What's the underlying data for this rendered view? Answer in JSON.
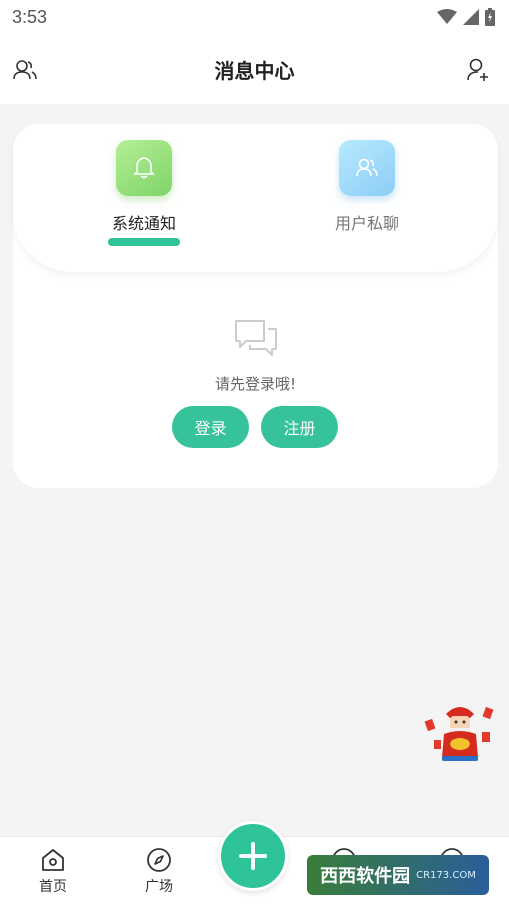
{
  "status_bar": {
    "time": "3:53"
  },
  "header": {
    "title": "消息中心"
  },
  "tabs": [
    {
      "label": "系统通知",
      "icon": "bell-icon",
      "active": true
    },
    {
      "label": "用户私聊",
      "icon": "users-icon",
      "active": false
    }
  ],
  "empty_state": {
    "icon": "chat-bubbles-icon",
    "text": "请先登录哦!",
    "login_label": "登录",
    "register_label": "注册"
  },
  "bottom_nav": {
    "home_label": "首页",
    "square_label": "广场",
    "fab_icon": "plus-icon"
  },
  "watermark": {
    "main": "西西软件园",
    "sub": "CR173.COM"
  },
  "colors": {
    "accent": "#36c29b",
    "background": "#f4f4f5"
  }
}
